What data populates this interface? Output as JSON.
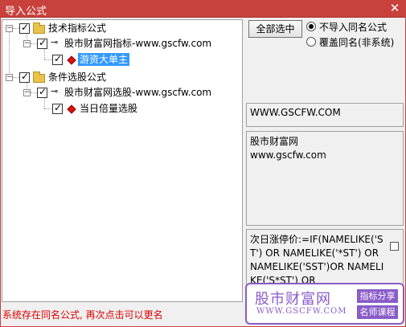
{
  "window": {
    "title": "导入公式",
    "close_glyph": "✕"
  },
  "tree": {
    "root1": {
      "label": "技术指标公式",
      "child": {
        "label": "股市财富网指标-www.gscfw.com",
        "leaf": {
          "label": "游资大单主",
          "selected": true
        }
      }
    },
    "root2": {
      "label": "条件选股公式",
      "child": {
        "label": "股市财富网选股-www.gscfw.com",
        "leaf": {
          "label": "当日倍量选股",
          "selected": false
        }
      }
    }
  },
  "actions": {
    "select_all_label": "全部选中"
  },
  "options": {
    "no_import_label": "不导入同名公式",
    "overwrite_label": "覆盖同名(非系统)",
    "selected": "no_import"
  },
  "info": {
    "url": "WWW.GSCFW.COM",
    "desc_line1": "股市财富网",
    "desc_line2": "www.gscfw.com",
    "formula": "次日涨停价:=IF(NAMELIKE('ST') OR NAMELIKE('*ST') OR  NAMELIKE('SST')OR NAMELIKE('S*ST') OR"
  },
  "status": {
    "message": "系统存在同名公式, 再次点击可以更名"
  },
  "watermark": {
    "brand": "股市财富网",
    "url": "WWW.GSCFW.COM",
    "tag1": "指标分享",
    "tag2": "名师课程"
  },
  "colors": {
    "title_bar": "#c8413d",
    "selection": "#3399ff",
    "status_text": "#dd0000",
    "watermark": "#8a5cc9"
  }
}
